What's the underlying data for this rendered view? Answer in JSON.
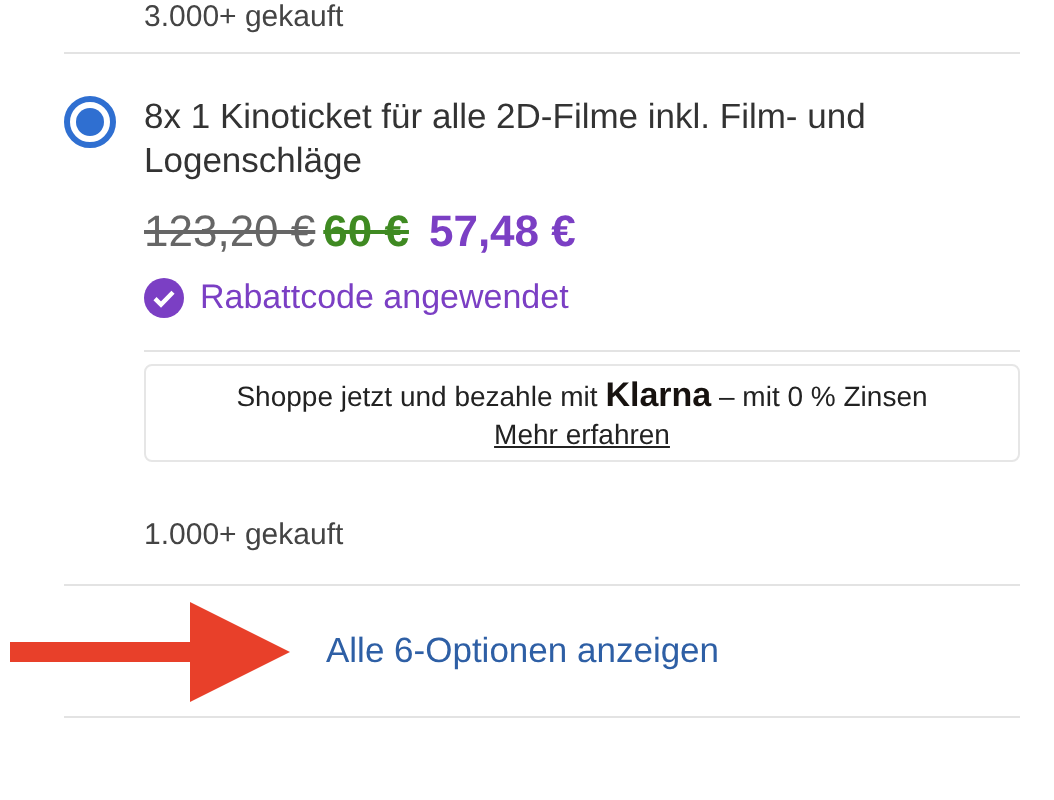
{
  "previous_option": {
    "purchased": "3.000+ gekauft"
  },
  "option": {
    "selected": true,
    "title": "8x 1 Kinoticket für alle 2D-Filme inkl. Film- und Logenschläge",
    "original_price": "123,20 €",
    "deal_price": "60 €",
    "final_price": "57,48 €",
    "discount": {
      "applied": true,
      "label": "Rabattcode angewendet"
    },
    "klarna": {
      "text": "Shoppe jetzt und bezahle mit **Klarna** – mit 0 % Zinsen",
      "link": "Mehr erfahren"
    },
    "purchased": "1.000+ gekauft"
  },
  "show_all_link": "Alle 6-Optionen anzeigen"
}
